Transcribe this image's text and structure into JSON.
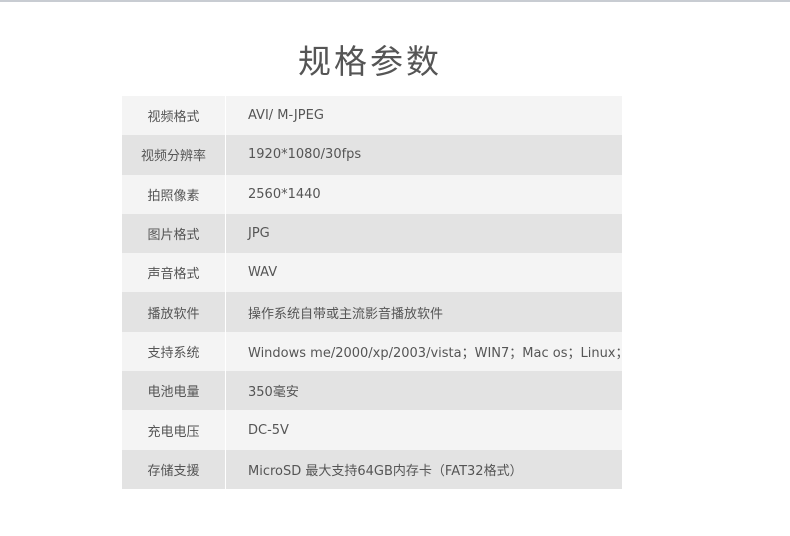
{
  "title": "规格参数",
  "specs": [
    {
      "label": "视频格式",
      "value": "AVI/ M-JPEG"
    },
    {
      "label": "视频分辨率",
      "value": "1920*1080/30fps"
    },
    {
      "label": "拍照像素",
      "value": "2560*1440"
    },
    {
      "label": "图片格式",
      "value": "JPG"
    },
    {
      "label": "声音格式",
      "value": "WAV"
    },
    {
      "label": "播放软件",
      "value": "操作系统自带或主流影音播放软件"
    },
    {
      "label": "支持系统",
      "value": "Windows me/2000/xp/2003/vista；WIN7；Mac os；Linux；"
    },
    {
      "label": "电池电量",
      "value": "350毫安"
    },
    {
      "label": "充电电压",
      "value": "DC-5V"
    },
    {
      "label": "存储支援",
      "value": "MicroSD 最大支持64GB内存卡（FAT32格式）"
    }
  ]
}
